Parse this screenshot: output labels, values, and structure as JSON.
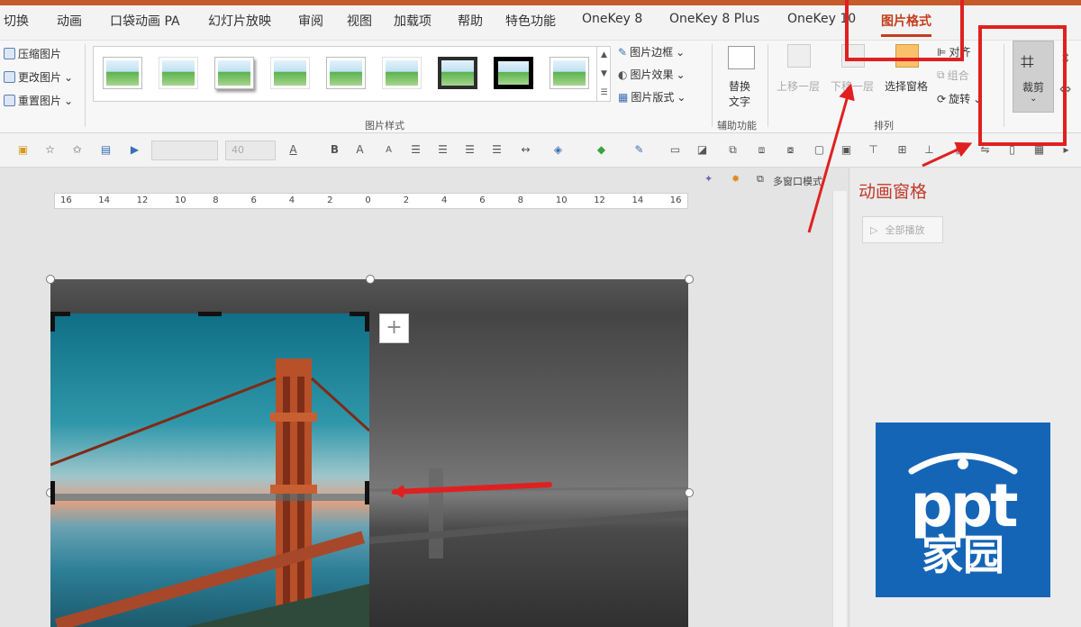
{
  "tabs": [
    "切换",
    "动画",
    "口袋动画 PA",
    "幻灯片放映",
    "审阅",
    "视图",
    "加载项",
    "帮助",
    "特色功能",
    "OneKey 8",
    "OneKey 8 Plus",
    "OneKey 10",
    "图片格式"
  ],
  "active_tab": "图片格式",
  "ribbon": {
    "adjust": [
      "压缩图片",
      "更改图片",
      "重置图片"
    ],
    "styles_group_label": "图片样式",
    "style_options": [
      "图片边框",
      "图片效果",
      "图片版式"
    ],
    "alt_text": [
      "替换",
      "文字"
    ],
    "accessibility_label": "辅助功能",
    "arrange": {
      "bring_forward": "上移一层",
      "send_backward": "下移一层",
      "selection_pane": "选择窗格",
      "align": "对齐",
      "group": "组合",
      "rotate": "旋转",
      "label": "排列"
    },
    "crop": "裁剪"
  },
  "format_toolbar": {
    "font_size": "40",
    "bold": "B"
  },
  "view_bar": {
    "multi_window": "多窗口模式"
  },
  "ruler_ticks": [
    "16",
    "14",
    "12",
    "10",
    "8",
    "6",
    "4",
    "2",
    "0",
    "2",
    "4",
    "6",
    "8",
    "10",
    "12",
    "14",
    "16"
  ],
  "animation_pane": {
    "title": "动画窗格",
    "play_all": "全部播放"
  },
  "logo": {
    "line1": "ppt",
    "line2": "家园"
  },
  "colors": {
    "accent": "#c43e1c",
    "annotation": "#e02020",
    "logo_bg": "#1565b7"
  }
}
